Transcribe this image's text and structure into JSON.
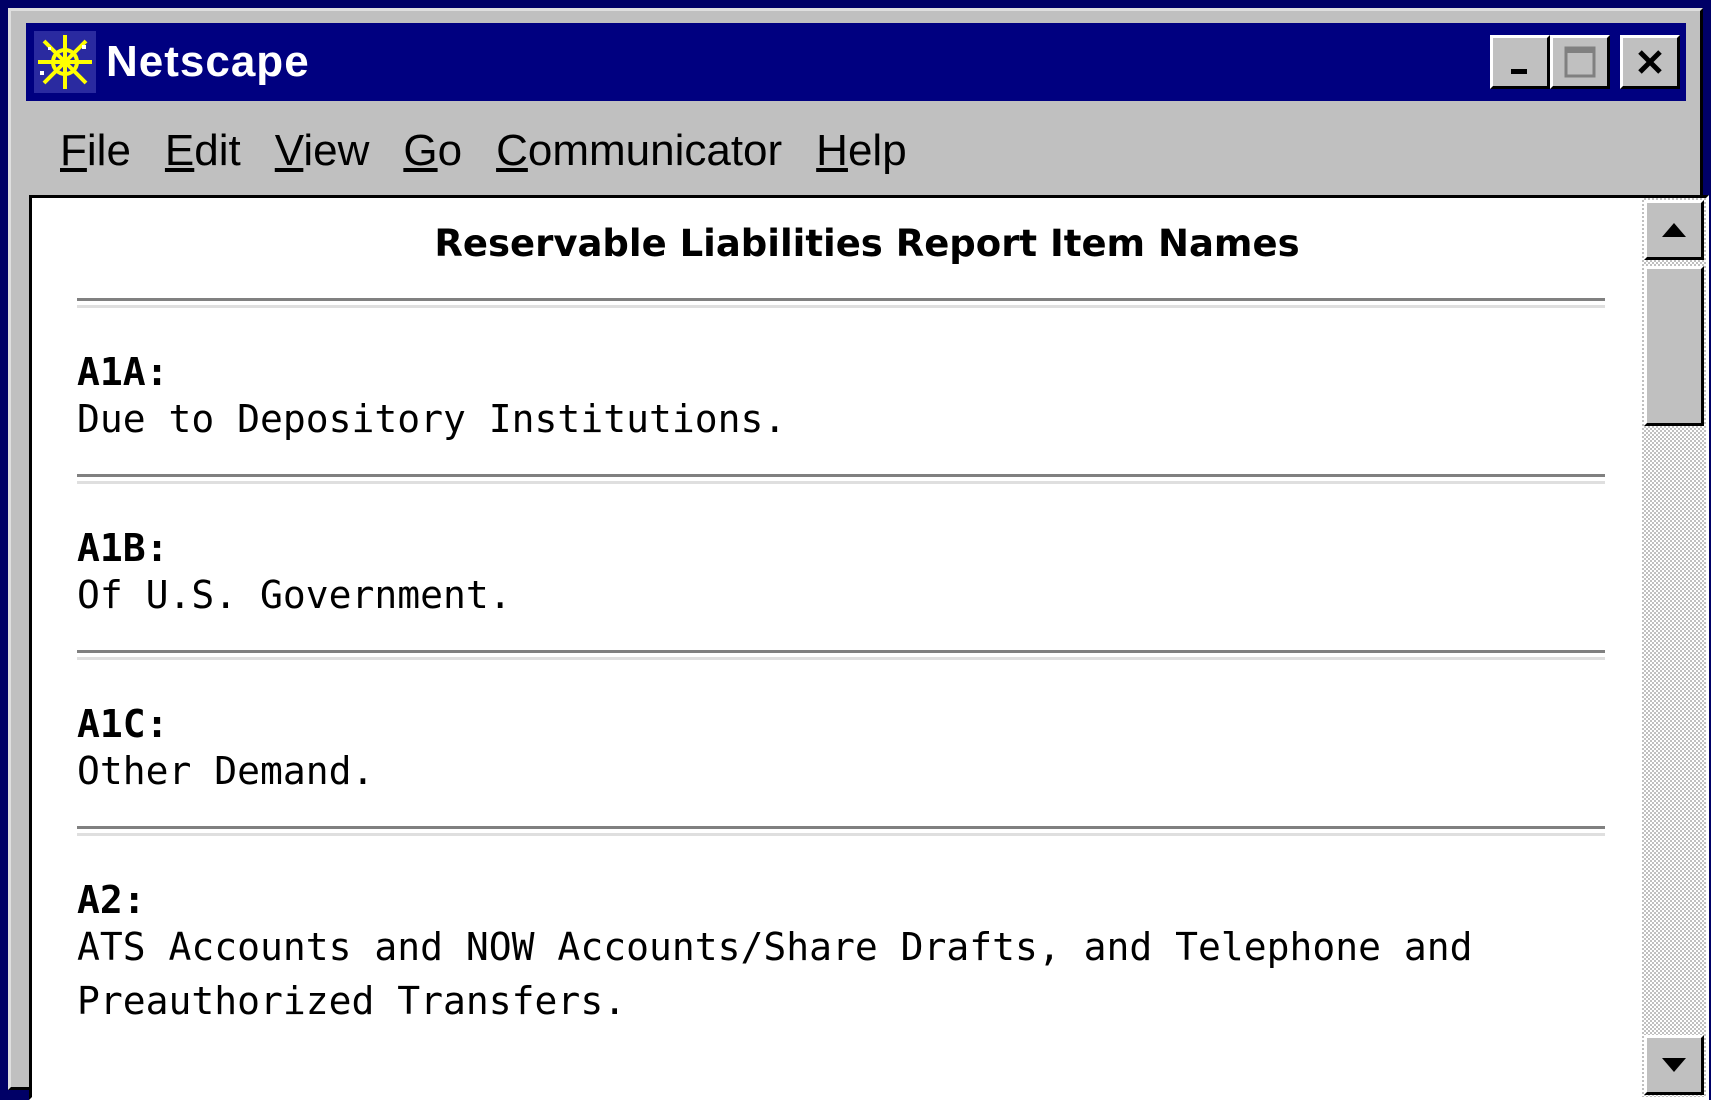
{
  "window": {
    "title": "Netscape",
    "app_icon": "netscape-icon"
  },
  "window_controls": {
    "minimize_icon": "minimize-icon",
    "maximize_icon": "maximize-icon",
    "close_icon": "close-icon"
  },
  "menu": [
    {
      "accel": "F",
      "rest": "ile"
    },
    {
      "accel": "E",
      "rest": "dit"
    },
    {
      "accel": "V",
      "rest": "iew"
    },
    {
      "accel": "G",
      "rest": "o"
    },
    {
      "accel": "C",
      "rest": "ommunicator"
    },
    {
      "accel": "H",
      "rest": "elp"
    }
  ],
  "page": {
    "title": "Reservable Liabilities Report Item Names",
    "items": [
      {
        "code": "A1A:",
        "description": "Due to Depository Institutions."
      },
      {
        "code": "A1B:",
        "description": "Of U.S. Government."
      },
      {
        "code": "A1C:",
        "description": "Other Demand."
      },
      {
        "code": "A2:",
        "description": "ATS Accounts and NOW Accounts/Share Drafts, and Telephone and Preauthorized Transfers."
      }
    ]
  },
  "scrollbar": {
    "up_icon": "scroll-up-arrow-icon",
    "down_icon": "scroll-down-arrow-icon"
  },
  "colors": {
    "desktop": "#000066",
    "titlebar": "#000080",
    "chrome": "#c0c0c0",
    "page_background": "#ffffff"
  }
}
